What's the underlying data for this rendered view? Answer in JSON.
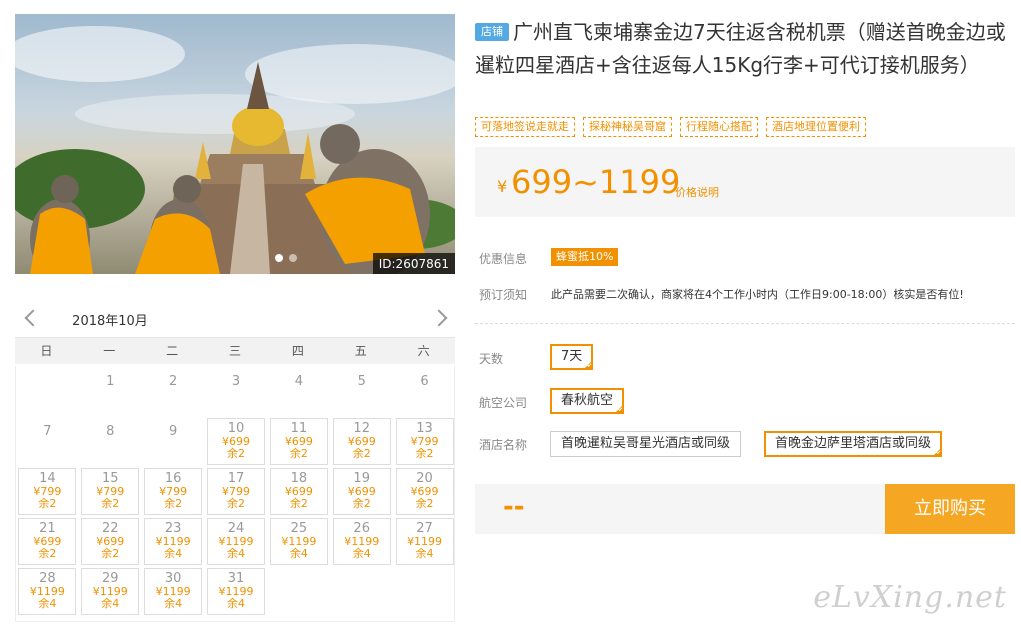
{
  "hero": {
    "id_label": "ID:2607861"
  },
  "calendar": {
    "month": "2018年10月",
    "weekdays": [
      "日",
      "一",
      "二",
      "三",
      "四",
      "五",
      "六"
    ],
    "plain_days": [
      "1",
      "2",
      "3",
      "4",
      "5",
      "6",
      "7",
      "8",
      "9"
    ],
    "days": [
      {
        "d": "10",
        "p": "¥699",
        "s": "余2"
      },
      {
        "d": "11",
        "p": "¥699",
        "s": "余2"
      },
      {
        "d": "12",
        "p": "¥699",
        "s": "余2"
      },
      {
        "d": "13",
        "p": "¥799",
        "s": "余2"
      },
      {
        "d": "14",
        "p": "¥799",
        "s": "余2"
      },
      {
        "d": "15",
        "p": "¥799",
        "s": "余2"
      },
      {
        "d": "16",
        "p": "¥799",
        "s": "余2"
      },
      {
        "d": "17",
        "p": "¥799",
        "s": "余2"
      },
      {
        "d": "18",
        "p": "¥699",
        "s": "余2"
      },
      {
        "d": "19",
        "p": "¥699",
        "s": "余2"
      },
      {
        "d": "20",
        "p": "¥699",
        "s": "余2"
      },
      {
        "d": "21",
        "p": "¥699",
        "s": "余2"
      },
      {
        "d": "22",
        "p": "¥699",
        "s": "余2"
      },
      {
        "d": "23",
        "p": "¥1199",
        "s": "余4"
      },
      {
        "d": "24",
        "p": "¥1199",
        "s": "余4"
      },
      {
        "d": "25",
        "p": "¥1199",
        "s": "余4"
      },
      {
        "d": "26",
        "p": "¥1199",
        "s": "余4"
      },
      {
        "d": "27",
        "p": "¥1199",
        "s": "余4"
      },
      {
        "d": "28",
        "p": "¥1199",
        "s": "余4"
      },
      {
        "d": "29",
        "p": "¥1199",
        "s": "余4"
      },
      {
        "d": "30",
        "p": "¥1199",
        "s": "余4"
      },
      {
        "d": "31",
        "p": "¥1199",
        "s": "余4"
      }
    ]
  },
  "product": {
    "shop_tag": "店铺",
    "title": "广州直飞柬埔寨金边7天往返含税机票（赠送首晚金边或暹粒四星酒店+含往返每人15Kg行李+可代订接机服务）",
    "tags": [
      "可落地签说走就走",
      "探秘神秘吴哥窟",
      "行程随心搭配",
      "酒店地理位置便利"
    ],
    "currency": "¥",
    "price": "699~1199",
    "price_note": "价格说明"
  },
  "info": {
    "discount_label": "优惠信息",
    "discount_badge": "蜂蜜抵10%",
    "notice_label": "预订须知",
    "notice_text": "此产品需要二次确认，商家将在4个工作小时内（工作日9:00-18:00）核实是否有位!"
  },
  "options": {
    "days_label": "天数",
    "days_value": "7天",
    "airline_label": "航空公司",
    "airline_value": "春秋航空",
    "hotel_label": "酒店名称",
    "hotel_1": "首晚暹粒吴哥星光酒店或同级",
    "hotel_2": "首晚金边萨里塔酒店或同级"
  },
  "buy": {
    "total": "--",
    "button": "立即购买"
  },
  "watermark": "eLvXing.net",
  "colors": {
    "accent": "#f29100",
    "button": "#f5a623",
    "shop_tag": "#55a9e3"
  }
}
